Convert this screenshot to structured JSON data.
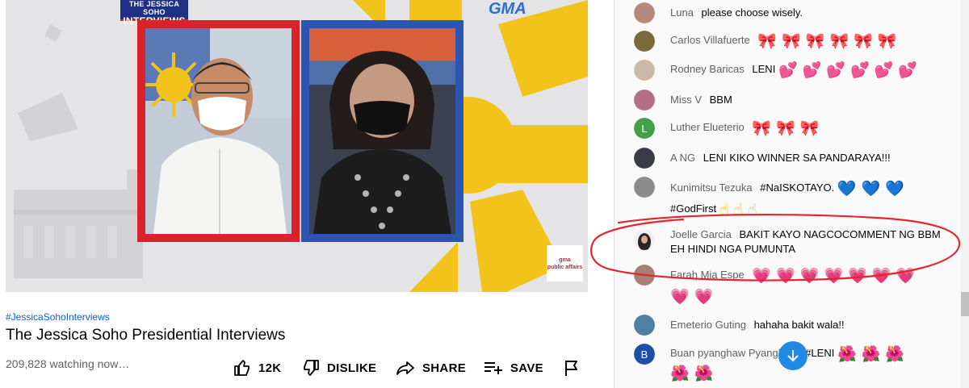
{
  "video": {
    "show_logo_line1": "THE JESSICA SOHO",
    "show_logo_line2": "INTERVIEWS",
    "network_logo": "GMA",
    "badge_line1": "gma",
    "badge_line2": "public affairs",
    "colors": {
      "red_frame": "#d8232a",
      "blue_frame": "#2b55b0",
      "sun": "#f2c31b"
    }
  },
  "hashtag": "#JessicaSohoInterviews",
  "title": "The Jessica Soho Presidential Interviews",
  "views": "209,828 watching now…",
  "actions": {
    "like_count": "12K",
    "dislike_label": "DISLIKE",
    "share_label": "SHARE",
    "save_label": "SAVE"
  },
  "chat": {
    "messages": [
      {
        "author": "Luna",
        "text": "please choose wisely.",
        "emoji": "",
        "emoji2": "",
        "avatar_color": "#b48a7a"
      },
      {
        "author": "Carlos Villafuerte",
        "text": "",
        "emoji": "🎀 🎀 🎀 🎀 🎀 🎀",
        "emoji2": "",
        "avatar_color": "#7a6a3b"
      },
      {
        "author": "Rodney Baricas",
        "text": "LENI",
        "emoji": "💕 💕 💕 💕 💕 💕",
        "emoji2": "",
        "avatar_color": "#c9b9a8"
      },
      {
        "author": "Miss V",
        "text": "BBM",
        "emoji": "",
        "emoji2": "",
        "avatar_color": "#b26f86"
      },
      {
        "author": "Luther Elueterio",
        "text": "",
        "emoji": "🎀 🎀 🎀",
        "emoji2": "",
        "avatar_color": "#43a047",
        "avatar_letter": "L"
      },
      {
        "author": "A NG",
        "text": "LENI KIKO WINNER SA PANDARAYA!!!",
        "emoji": "",
        "emoji2": "",
        "avatar_color": "#3a3a46"
      },
      {
        "author": "Kunimitsu Tezuka",
        "text": "#NaISKOTAYO.",
        "emoji": "💙 💙 💙",
        "text2": "#GodFirst",
        "emoji2": "☝ ☝ ☝",
        "avatar_color": "#8c8c8c"
      },
      {
        "author": "Joelle Garcia",
        "text": "BAKIT KAYO NAGCOCOMMENT NG BBM EH HINDI NGA PUMUNTA",
        "emoji": "",
        "emoji2": "",
        "avatar_color": "#2c2420"
      },
      {
        "author": "Farah Mia Espe",
        "text": "",
        "emoji": "💗 💗 💗 💗 💗 💗 💗",
        "emoji2": "💗 💗",
        "avatar_color": "#a87f74"
      },
      {
        "author": "Emeterio Guting",
        "text": "hahaha bakit wala!!",
        "emoji": "",
        "emoji2": "",
        "avatar_color": "#4f7fa3"
      },
      {
        "author": "Buan pyanghaw Pyanghaw",
        "text": "#LENI",
        "emoji": "🌺 🌺 🌺",
        "emoji2": "🌺 🌺",
        "avatar_color": "#1e4fa8",
        "avatar_letter": "B"
      }
    ]
  },
  "icons": {
    "like": "thumbs-up-icon",
    "dislike": "thumbs-down-icon",
    "share": "share-arrow-icon",
    "save": "playlist-add-icon",
    "flag": "flag-icon",
    "scroll_down": "arrow-down-icon"
  }
}
